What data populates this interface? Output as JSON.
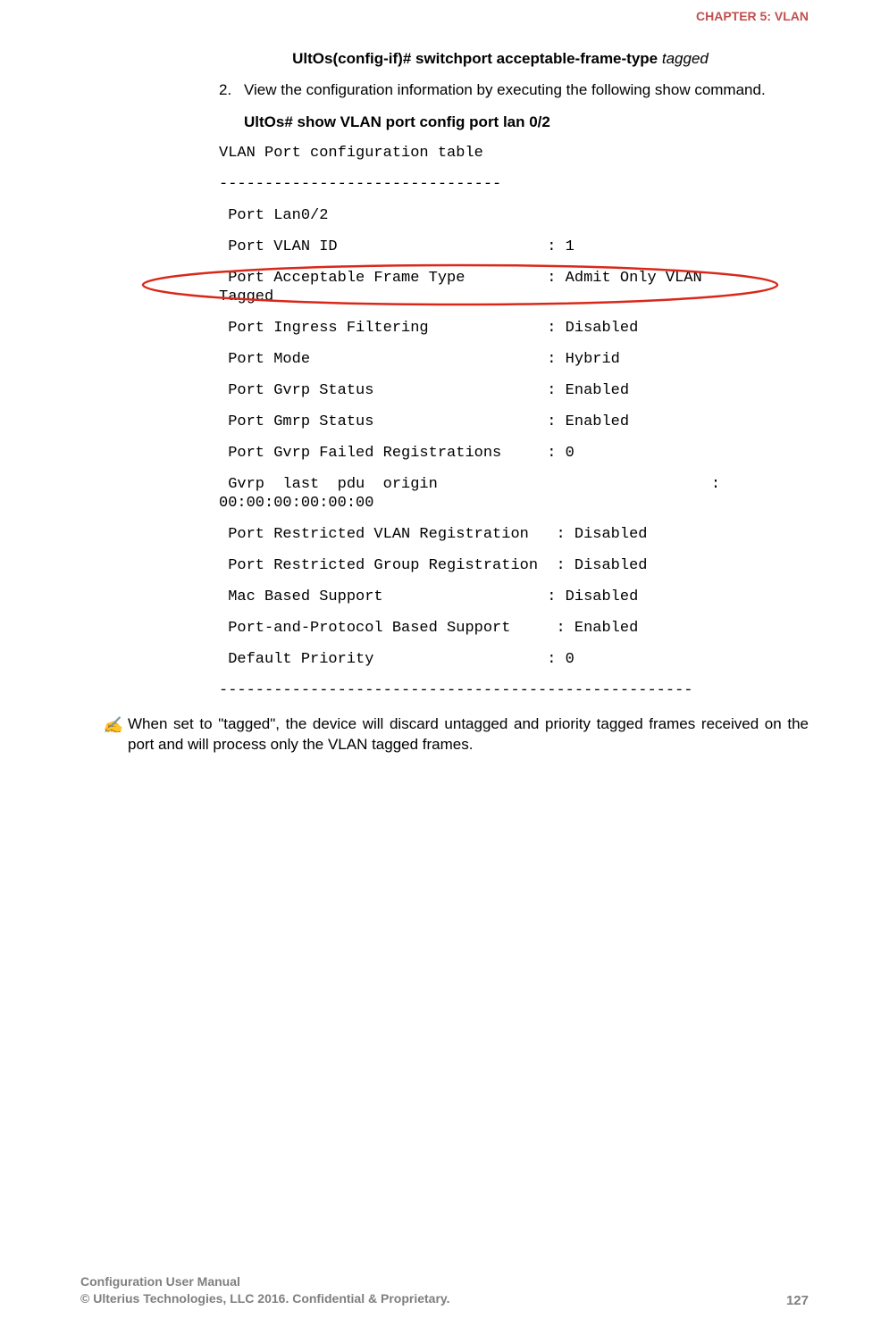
{
  "header": {
    "chapter": "CHAPTER 5: VLAN"
  },
  "main": {
    "command1_prefix": "UltOs(config-if)# switchport acceptable-frame-type ",
    "command1_param": "tagged",
    "step_number": "2.",
    "step_text": "View the configuration information by executing the following show command.",
    "command2": "UltOs# show VLAN port config port lan 0/2",
    "terminal": {
      "title": "VLAN Port configuration table",
      "sep_top": "-------------------------------",
      "port": " Port Lan0/2",
      "vlan_id": " Port VLAN ID                       : 1",
      "frame_type_line1": " Port Acceptable Frame Type         : Admit Only VLAN",
      "frame_type_line2": "Tagged",
      "ingress": " Port Ingress Filtering             : Disabled",
      "mode": " Port Mode                          : Hybrid",
      "gvrp": " Port Gvrp Status                   : Enabled",
      "gmrp": " Port Gmrp Status                   : Enabled",
      "gvrp_failed": " Port Gvrp Failed Registrations     : 0",
      "gvrp_pdu_line1": " Gvrp  last  pdu  origin                              :",
      "gvrp_pdu_line2": "00:00:00:00:00:00",
      "rest_vlan": " Port Restricted VLAN Registration   : Disabled",
      "rest_group": " Port Restricted Group Registration  : Disabled",
      "mac": " Mac Based Support                  : Disabled",
      "protocol": " Port-and-Protocol Based Support     : Enabled",
      "priority": " Default Priority                   : 0",
      "sep_bottom": "----------------------------------------------------"
    },
    "note_icon": "✍",
    "note_text": "When set to \"tagged\", the device will discard untagged and priority tagged frames received on the port and will process only the VLAN tagged frames."
  },
  "footer": {
    "left_line1": "Configuration User Manual",
    "left_line2": "© Ulterius Technologies, LLC 2016. Confidential & Proprietary.",
    "page_number": "127"
  }
}
